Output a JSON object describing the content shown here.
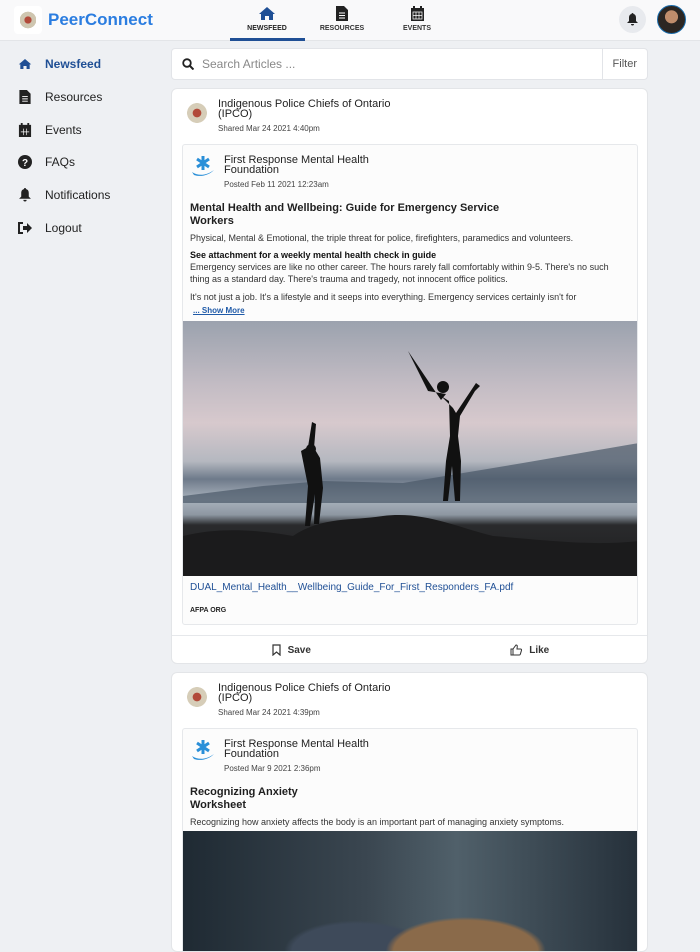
{
  "app": {
    "brand": "PeerConnect"
  },
  "topnav": {
    "tabs": [
      {
        "label": "NEWSFEED",
        "icon": "home-icon"
      },
      {
        "label": "RESOURCES",
        "icon": "document-icon"
      },
      {
        "label": "EVENTS",
        "icon": "calendar-icon"
      }
    ]
  },
  "sidebar": {
    "items": [
      {
        "label": "Newsfeed",
        "icon": "home-icon"
      },
      {
        "label": "Resources",
        "icon": "document-icon"
      },
      {
        "label": "Events",
        "icon": "calendar-icon"
      },
      {
        "label": "FAQs",
        "icon": "question-icon"
      },
      {
        "label": "Notifications",
        "icon": "bell-icon"
      },
      {
        "label": "Logout",
        "icon": "logout-icon"
      }
    ]
  },
  "search": {
    "placeholder": "Search Articles ...",
    "filter_label": "Filter"
  },
  "colors": {
    "accent": "#1f4f95",
    "brand": "#2b7de0"
  },
  "posts": [
    {
      "sharer": "Indigenous Police Chiefs of Ontario (IPCO)",
      "shared": "Shared Mar 24 2021 4:40pm",
      "org": "First Response Mental Health Foundation",
      "posted": "Posted Feb 11 2021 12:23am",
      "title": "Mental Health and Wellbeing: Guide for Emergency Service Workers",
      "summary": "Physical, Mental & Emotional, the triple threat for police, firefighters, paramedics and volunteers.",
      "bold": "See attachment for a weekly mental health check in guide",
      "body1": "Emergency services are like no other career. The hours rarely fall comfortably within 9-5. There's no such thing as a standard day. There's trauma and tragedy, not innocent office politics.",
      "body2": "It's not just a job. It's a lifestyle and it seeps into everything. Emergency services certainly isn't for",
      "show_more": "... Show More",
      "file": "DUAL_Mental_Health__Wellbeing_Guide_For_First_Responders_FA.pdf",
      "file_org": "AFPA ORG",
      "save": "Save",
      "like": "Like"
    },
    {
      "sharer": "Indigenous Police Chiefs of Ontario (IPCO)",
      "shared": "Shared Mar 24 2021 4:39pm",
      "org": "First Response Mental Health Foundation",
      "posted": "Posted Mar 9 2021 2:36pm",
      "title": "Recognizing Anxiety Worksheet",
      "summary": "Recognizing how anxiety affects the body is an important part of managing anxiety symptoms."
    }
  ]
}
